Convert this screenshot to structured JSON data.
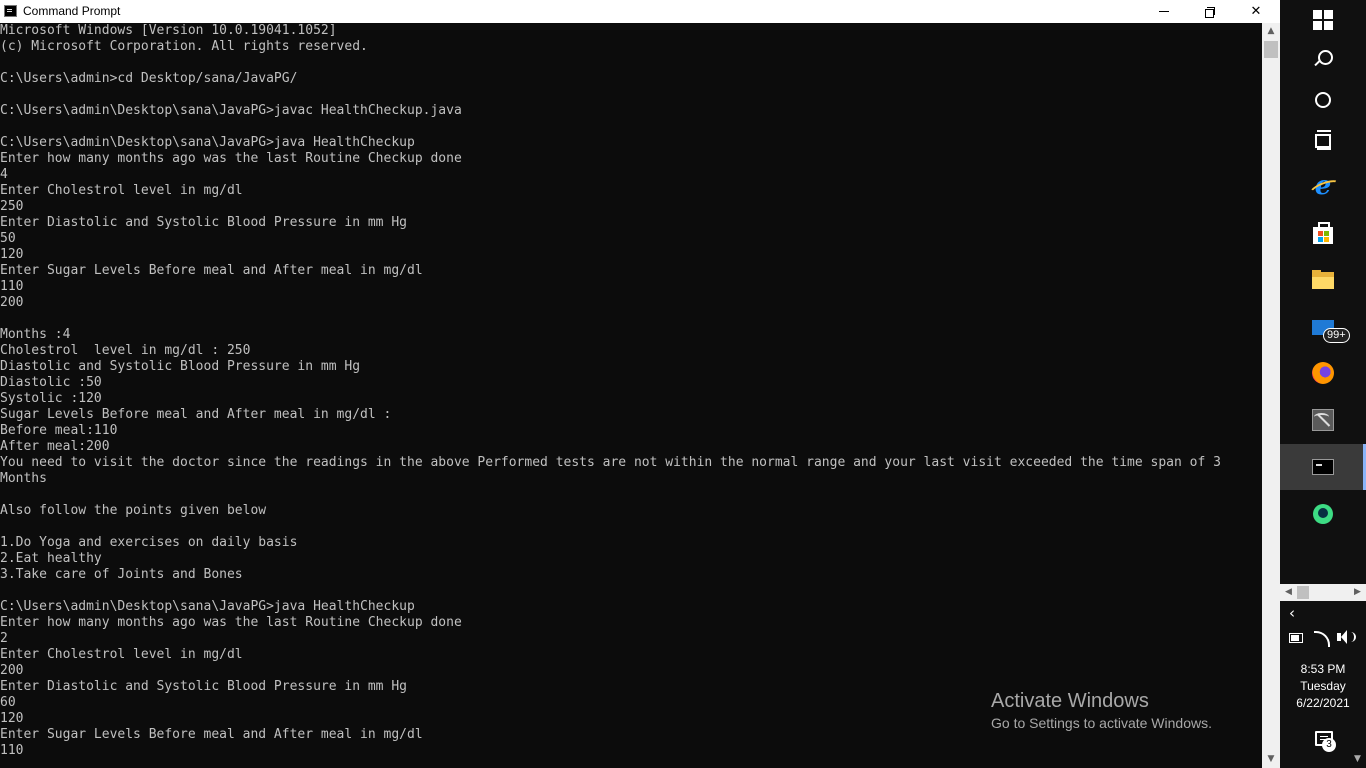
{
  "window": {
    "title": "Command Prompt",
    "minimize_label": "",
    "restore_label": "",
    "close_label": "✕"
  },
  "console": {
    "lines": [
      "Microsoft Windows [Version 10.0.19041.1052]",
      "(c) Microsoft Corporation. All rights reserved.",
      "",
      "C:\\Users\\admin>cd Desktop/sana/JavaPG/",
      "",
      "C:\\Users\\admin\\Desktop\\sana\\JavaPG>javac HealthCheckup.java",
      "",
      "C:\\Users\\admin\\Desktop\\sana\\JavaPG>java HealthCheckup",
      "Enter how many months ago was the last Routine Checkup done",
      "4",
      "Enter Cholestrol level in mg/dl",
      "250",
      "Enter Diastolic and Systolic Blood Pressure in mm Hg",
      "50",
      "120",
      "Enter Sugar Levels Before meal and After meal in mg/dl",
      "110",
      "200",
      "",
      "Months :4",
      "Cholestrol  level in mg/dl : 250",
      "Diastolic and Systolic Blood Pressure in mm Hg",
      "Diastolic :50",
      "Systolic :120",
      "Sugar Levels Before meal and After meal in mg/dl :",
      "Before meal:110",
      "After meal:200",
      "You need to visit the doctor since the readings in the above Performed tests are not within the normal range and your last visit exceeded the time span of 3",
      "Months",
      "",
      "Also follow the points given below",
      "",
      "1.Do Yoga and exercises on daily basis",
      "2.Eat healthy",
      "3.Take care of Joints and Bones",
      "",
      "C:\\Users\\admin\\Desktop\\sana\\JavaPG>java HealthCheckup",
      "Enter how many months ago was the last Routine Checkup done",
      "2",
      "Enter Cholestrol level in mg/dl",
      "200",
      "Enter Diastolic and Systolic Blood Pressure in mm Hg",
      "60",
      "120",
      "Enter Sugar Levels Before meal and After meal in mg/dl",
      "110"
    ]
  },
  "watermark": {
    "title": "Activate Windows",
    "subtitle": "Go to Settings to activate Windows."
  },
  "taskbar": {
    "items": [
      {
        "name": "start-button",
        "icon": "windows-logo-icon"
      },
      {
        "name": "search-button",
        "icon": "search-icon"
      },
      {
        "name": "cortana-button",
        "icon": "cortana-icon"
      },
      {
        "name": "task-view-button",
        "icon": "task-view-icon"
      },
      {
        "name": "internet-explorer-button",
        "icon": "internet-explorer-icon"
      },
      {
        "name": "microsoft-store-button",
        "icon": "store-icon"
      },
      {
        "name": "file-explorer-button",
        "icon": "folder-icon"
      },
      {
        "name": "mail-button",
        "icon": "mail-icon"
      },
      {
        "name": "firefox-button",
        "icon": "firefox-icon"
      },
      {
        "name": "tools-app-button",
        "icon": "tools-icon"
      },
      {
        "name": "command-prompt-taskbar-button",
        "icon": "command-prompt-icon"
      },
      {
        "name": "android-studio-button",
        "icon": "android-studio-icon"
      }
    ],
    "mail_badge": "99+",
    "clock": {
      "time": "8:53 PM",
      "day": "Tuesday",
      "date": "6/22/2021"
    },
    "notification_count": "3",
    "colors": {
      "background": "#101010",
      "active": "#3a3a3a"
    }
  },
  "colors": {
    "console_background": "#0c0c0c",
    "console_text": "#c0c0c0",
    "titlebar": "#ffffff",
    "watermark_text": "#a8a8a8"
  }
}
